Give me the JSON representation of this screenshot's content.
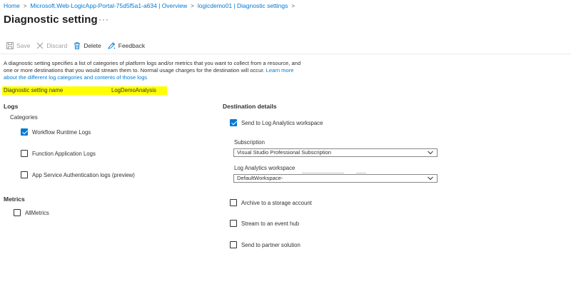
{
  "breadcrumb": {
    "items": [
      "Home",
      "Microsoft.Web-LogicApp-Portal-75d5f5a1-a634 | Overview",
      "logicdemo01 | Diagnostic settings"
    ]
  },
  "page": {
    "title": "Diagnostic setting",
    "more_label": "···"
  },
  "toolbar": {
    "save": "Save",
    "discard": "Discard",
    "delete": "Delete",
    "feedback": "Feedback"
  },
  "description": {
    "text": "A diagnostic setting specifies a list of categories of platform logs and/or metrics that you want to collect from a resource, and one or more destinations that you would stream them to. Normal usage charges for the destination will occur. ",
    "link": "Learn more about the different log categories and contents of those logs"
  },
  "setting_name": {
    "label": "Diagnostic setting name",
    "value": "LogDemoAnalysis"
  },
  "logs": {
    "heading": "Logs",
    "categories_label": "Categories",
    "items": [
      {
        "label": "Workflow Runtime Logs",
        "checked": true
      },
      {
        "label": "Function Application Logs",
        "checked": false
      },
      {
        "label": "App Service Authentication logs (preview)",
        "checked": false
      }
    ]
  },
  "metrics": {
    "heading": "Metrics",
    "items": [
      {
        "label": "AllMetrics",
        "checked": false
      }
    ]
  },
  "destination": {
    "heading": "Destination details",
    "send_la": {
      "label": "Send to Log Analytics workspace",
      "checked": true
    },
    "subscription": {
      "label": "Subscription",
      "value": "Visual Studio Professional Subscription"
    },
    "workspace": {
      "label": "Log Analytics workspace",
      "value": "DefaultWorkspace-"
    },
    "archive": {
      "label": "Archive to a storage account",
      "checked": false
    },
    "event_hub": {
      "label": "Stream to an event hub",
      "checked": false
    },
    "partner": {
      "label": "Send to partner solution",
      "checked": false
    }
  },
  "colors": {
    "accent": "#0078d4",
    "highlight": "#ffff00",
    "text": "#323130"
  },
  "icons": {
    "save": "save-icon",
    "discard": "discard-icon",
    "delete": "trash-icon",
    "feedback": "feedback-icon",
    "chevron": "chevron-down-icon"
  }
}
